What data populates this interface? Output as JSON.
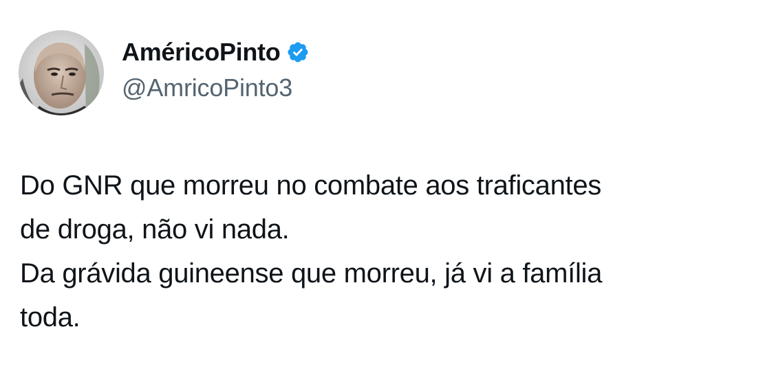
{
  "author": {
    "display_name": "AméricoPinto",
    "handle": "@AmricoPinto3",
    "verified": true,
    "verified_icon": "verified-badge-icon",
    "avatar_icon": "profile-photo"
  },
  "tweet": {
    "lines": [
      "Do GNR que morreu no combate aos traficantes",
      "de droga, não vi nada.",
      "Da grávida guineense que morreu, já vi a família",
      "toda."
    ]
  },
  "colors": {
    "text": "#0f1419",
    "secondary_text": "#536471",
    "verified_blue": "#1d9bf0",
    "background": "#ffffff"
  }
}
